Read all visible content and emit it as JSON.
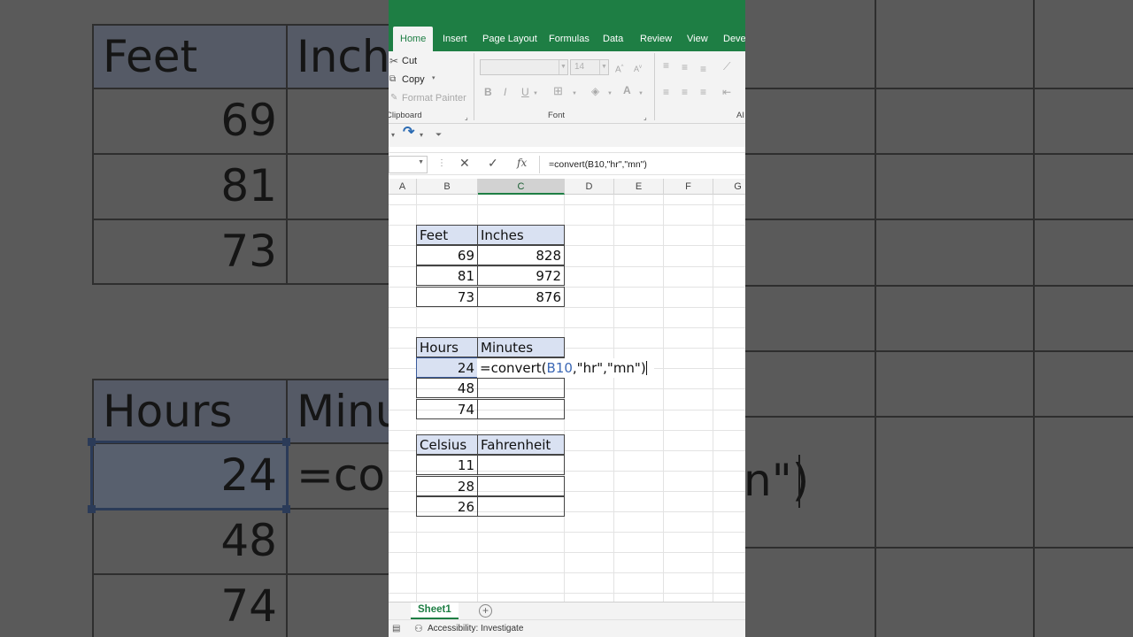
{
  "ribbon": {
    "tabs": [
      "Home",
      "Insert",
      "Page Layout",
      "Formulas",
      "Data",
      "Review",
      "View",
      "Devel"
    ],
    "clipboard": {
      "cut": "Cut",
      "copy": "Copy",
      "format_painter": "Format Painter",
      "group_label": "Clipboard"
    },
    "font": {
      "size": "14",
      "group_label": "Font",
      "bold": "B",
      "italic": "I",
      "underline": "U",
      "font_color": "A"
    },
    "alignment_group_label": "Al"
  },
  "formula_bar": {
    "formula": "=convert(B10,\"hr\",\"mn\")"
  },
  "columns": [
    "A",
    "B",
    "C",
    "D",
    "E",
    "F",
    "G"
  ],
  "tables": {
    "feet": {
      "headers": [
        "Feet",
        "Inches"
      ],
      "rows": [
        [
          "69",
          "828"
        ],
        [
          "81",
          "972"
        ],
        [
          "73",
          "876"
        ]
      ]
    },
    "hours": {
      "headers": [
        "Hours",
        "Minutes"
      ],
      "rows": [
        [
          "24",
          ""
        ],
        [
          "48",
          ""
        ],
        [
          "74",
          ""
        ]
      ],
      "edit": {
        "prefix": "=convert(",
        "ref": "B10",
        "suffix": ",\"hr\",\"mn\")"
      }
    },
    "celsius": {
      "headers": [
        "Celsius",
        "Fahrenheit"
      ],
      "rows": [
        [
          "11",
          ""
        ],
        [
          "28",
          ""
        ],
        [
          "26",
          ""
        ]
      ]
    }
  },
  "sheet": {
    "tab": "Sheet1",
    "add_symbol": "+"
  },
  "status": {
    "accessibility": "Accessibility: Investigate"
  },
  "colors": {
    "excel_green": "#1e7e44",
    "header_fill": "#d9e1f2",
    "reference_blue": "#3c68b5"
  }
}
